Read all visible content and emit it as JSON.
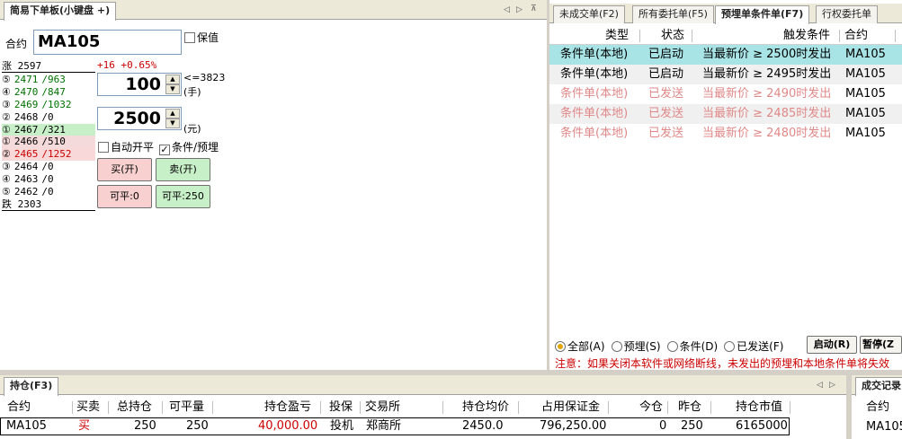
{
  "order_panel": {
    "tab_title": "简易下单板(小键盘 +)",
    "contract_label": "合约",
    "contract_value": "MA105",
    "keep_value_label": "保值",
    "limit_up_label": "涨",
    "limit_up_price": "2597",
    "limit_down_label": "跌",
    "limit_down_price": "2303",
    "change_text": "+16 +0.65%",
    "ask_levels": [
      {
        "level": "⑤",
        "price": "2471",
        "vol": "/963"
      },
      {
        "level": "④",
        "price": "2470",
        "vol": "/847"
      },
      {
        "level": "③",
        "price": "2469",
        "vol": "/1032"
      },
      {
        "level": "②",
        "price": "2468",
        "vol": "/0"
      },
      {
        "level": "①",
        "price": "2467",
        "vol": "/321"
      }
    ],
    "bid_levels": [
      {
        "level": "①",
        "price": "2466",
        "vol": "/510"
      },
      {
        "level": "②",
        "price": "2465",
        "vol": "/1252"
      },
      {
        "level": "③",
        "price": "2464",
        "vol": "/0"
      },
      {
        "level": "④",
        "price": "2463",
        "vol": "/0"
      },
      {
        "level": "⑤",
        "price": "2462",
        "vol": "/0"
      }
    ],
    "max_qty_label": "<=3823",
    "qty_value": "100",
    "qty_unit": "(手)",
    "price_value": "2500",
    "price_unit": "(元)",
    "auto_open_close_label": "自动开平",
    "conditional_label": "条件/预埋",
    "buy_label": "买(开)",
    "sell_label": "卖(开)",
    "buy_avail_label": "可平:0",
    "sell_avail_label": "可平:250"
  },
  "orders_panel": {
    "tabs": [
      "未成交单(F2)",
      "所有委托单(F5)",
      "预埋单条件单(F7)",
      "行权委托单"
    ],
    "columns": [
      "类型",
      "状态",
      "触发条件",
      "合约"
    ],
    "rows": [
      {
        "type": "条件单(本地)",
        "status": "已启动",
        "trigger": "当最新价 ≥ 2500时发出",
        "contract": "MA105"
      },
      {
        "type": "条件单(本地)",
        "status": "已启动",
        "trigger": "当最新价 ≥ 2495时发出",
        "contract": "MA105"
      },
      {
        "type": "条件单(本地)",
        "status": "已发送",
        "trigger": "当最新价 ≥ 2490时发出",
        "contract": "MA105"
      },
      {
        "type": "条件单(本地)",
        "status": "已发送",
        "trigger": "当最新价 ≥ 2485时发出",
        "contract": "MA105"
      },
      {
        "type": "条件单(本地)",
        "status": "已发送",
        "trigger": "当最新价 ≥ 2480时发出",
        "contract": "MA105"
      }
    ],
    "filters": [
      "全部(A)",
      "预埋(S)",
      "条件(D)",
      "已发送(F)"
    ],
    "start_label": "启动(R)",
    "pause_label": "暂停(Z",
    "notice": "注意：如果关闭本软件或网络断线，未发出的预埋和本地条件单将失效"
  },
  "positions_panel": {
    "tab_title": "持仓(F3)",
    "columns": [
      "合约",
      "买卖",
      "总持仓",
      "可平量",
      "持仓盈亏",
      "投保",
      "交易所",
      "持仓均价",
      "占用保证金",
      "今仓",
      "昨仓",
      "持仓市值"
    ],
    "row": [
      "MA105",
      "买",
      "250",
      "250",
      "40,000.00",
      "投机",
      "郑商所",
      "2450.0",
      "796,250.00",
      "0",
      "250",
      "6165000"
    ]
  },
  "trades_panel": {
    "tab_title": "成交记录",
    "column": "合约",
    "value": "MA105"
  },
  "colors": {
    "red": "#cc0000",
    "green": "#007000",
    "selected_row": "#a8e4e6",
    "sent_text": "#e08888",
    "buy_btn": "#f8d0d0",
    "sell_btn": "#c8f0c8"
  }
}
